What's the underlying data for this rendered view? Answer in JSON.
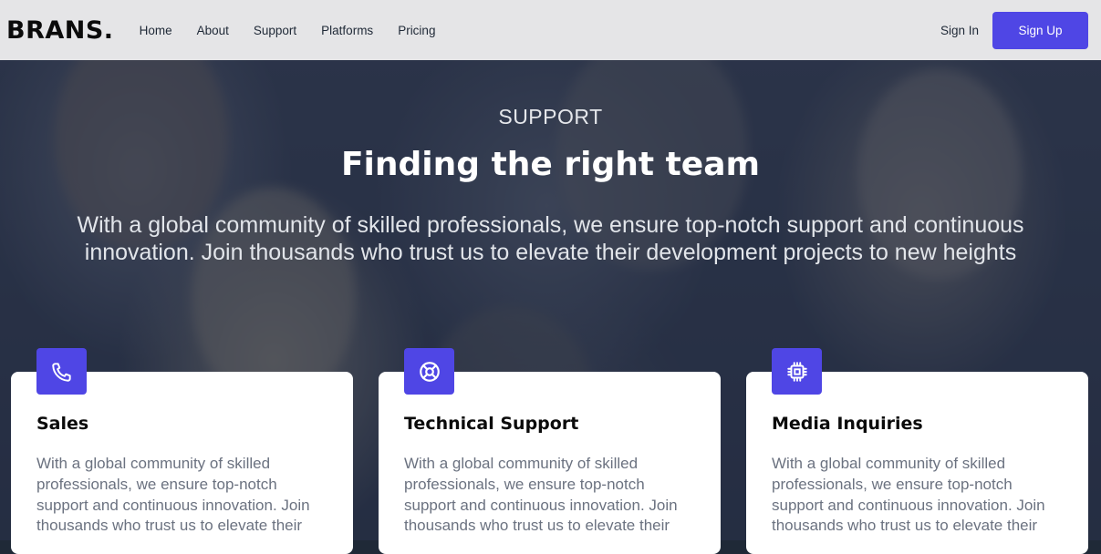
{
  "nav": {
    "logo": "BRANS.",
    "links": [
      "Home",
      "About",
      "Support",
      "Platforms",
      "Pricing"
    ],
    "sign_in": "Sign In",
    "sign_up": "Sign Up"
  },
  "hero": {
    "eyebrow": "SUPPORT",
    "title": "Finding the right team",
    "text": "With a global community of skilled professionals, we ensure top-notch support and continuous innovation. Join thousands who trust us to elevate their development projects to new heights"
  },
  "cards": [
    {
      "icon": "phone-icon",
      "title": "Sales",
      "text": "With a global community of skilled professionals, we ensure top-notch support and continuous innovation. Join thousands who trust us to elevate their"
    },
    {
      "icon": "lifebuoy-icon",
      "title": "Technical Support",
      "text": "With a global community of skilled professionals, we ensure top-notch support and continuous innovation. Join thousands who trust us to elevate their"
    },
    {
      "icon": "chip-icon",
      "title": "Media Inquiries",
      "text": "With a global community of skilled professionals, we ensure top-notch support and continuous innovation. Join thousands who trust us to elevate their"
    }
  ],
  "colors": {
    "accent": "#4f46e5",
    "navbar_bg": "#e5e5e7",
    "card_text": "#6b7280"
  }
}
